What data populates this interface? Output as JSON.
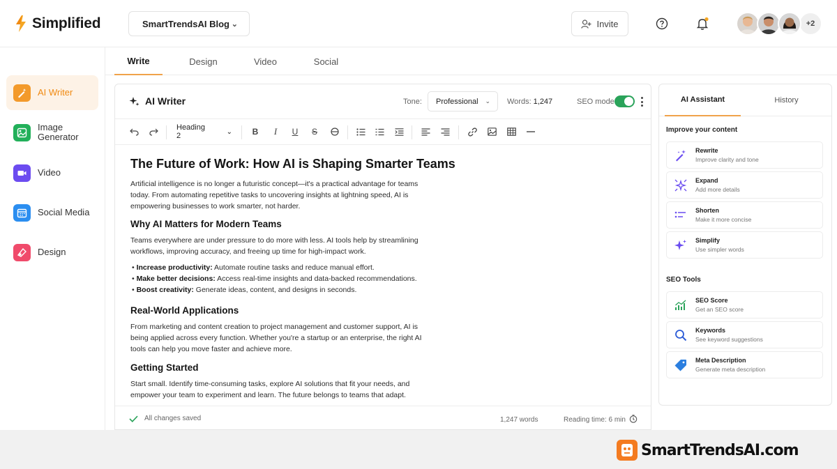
{
  "app": {
    "brand": "Simplified",
    "brand_color": "#f5a623",
    "workspace": "SmartTrendsAI Blog",
    "invite_label": "Invite",
    "more_members": "+2"
  },
  "sidebar": {
    "items": [
      {
        "label": "AI Writer",
        "icon": "pen-sparkle-icon",
        "color": "#f39a2b",
        "active": true
      },
      {
        "label": "Image Generator",
        "icon": "image-icon",
        "color": "#22b05a",
        "active": false
      },
      {
        "label": "Video",
        "icon": "video-camera-icon",
        "color": "#6c4cf0",
        "active": false
      },
      {
        "label": "Social Media",
        "icon": "calendar-icon",
        "color": "#2b8ef0",
        "active": false
      },
      {
        "label": "Design",
        "icon": "shapes-icon",
        "color": "#f04b6b",
        "active": false
      }
    ]
  },
  "top_tabs": [
    "Write",
    "Design",
    "Video",
    "Social"
  ],
  "editor": {
    "title": "AI Writer",
    "tone_label": "Tone:",
    "tone_value": "Professional",
    "words_label": "Words:",
    "words_value": "1,247",
    "seo_label": "SEO mode",
    "seo_on": true,
    "heading_select": "Heading 2"
  },
  "document": {
    "h1": "The Future of Work: How AI is Shaping Smarter Teams",
    "intro": "Artificial intelligence is no longer a futuristic concept—it's a practical advantage for teams today. From automating repetitive tasks to uncovering insights at lightning speed, AI is empowering businesses to work smarter, not harder.",
    "h2_1": "Why AI Matters for Modern Teams",
    "p_1": "Teams everywhere are under pressure to do more with less. AI tools help by streamlining workflows, improving accuracy, and freeing up time for high-impact work.",
    "bullets": [
      {
        "bold": "Increase productivity:",
        "text": " Automate routine tasks and reduce manual effort."
      },
      {
        "bold": "Make better decisions:",
        "text": " Access real-time insights and data-backed recommendations."
      },
      {
        "bold": "Boost creativity:",
        "text": " Generate ideas, content, and designs in seconds."
      }
    ],
    "h2_2": "Real-World Applications",
    "p_2": "From marketing and content creation to project management and customer support, AI is being applied across every function. Whether you're a startup or an enterprise, the right AI tools can help you move faster and achieve more.",
    "h2_3": "Getting Started",
    "p_3": "Start small. Identify time-consuming tasks, explore AI solutions that fit your needs, and empower your team to experiment and learn. The future belongs to teams that adapt."
  },
  "status": {
    "saved": "All changes saved",
    "words": "1,247 words",
    "reading": "Reading time: 6 min"
  },
  "assistant": {
    "tabs": [
      "AI Assistant",
      "History"
    ],
    "improve_heading": "Improve your content",
    "improve": [
      {
        "title": "Rewrite",
        "sub": "Improve clarity and tone",
        "icon": "magic-wand-icon"
      },
      {
        "title": "Expand",
        "sub": "Add more details",
        "icon": "expand-icon"
      },
      {
        "title": "Shorten",
        "sub": "Make it more concise",
        "icon": "shorten-icon"
      },
      {
        "title": "Simplify",
        "sub": "Use simpler words",
        "icon": "sparkle-icon"
      }
    ],
    "seo_heading": "SEO Tools",
    "seo": [
      {
        "title": "SEO Score",
        "sub": "Get an SEO score",
        "icon": "chart-icon"
      },
      {
        "title": "Keywords",
        "sub": "See keyword suggestions",
        "icon": "search-icon"
      },
      {
        "title": "Meta Description",
        "sub": "Generate meta description",
        "icon": "tag-icon"
      }
    ]
  },
  "watermark": "SmartTrendsAI.com"
}
